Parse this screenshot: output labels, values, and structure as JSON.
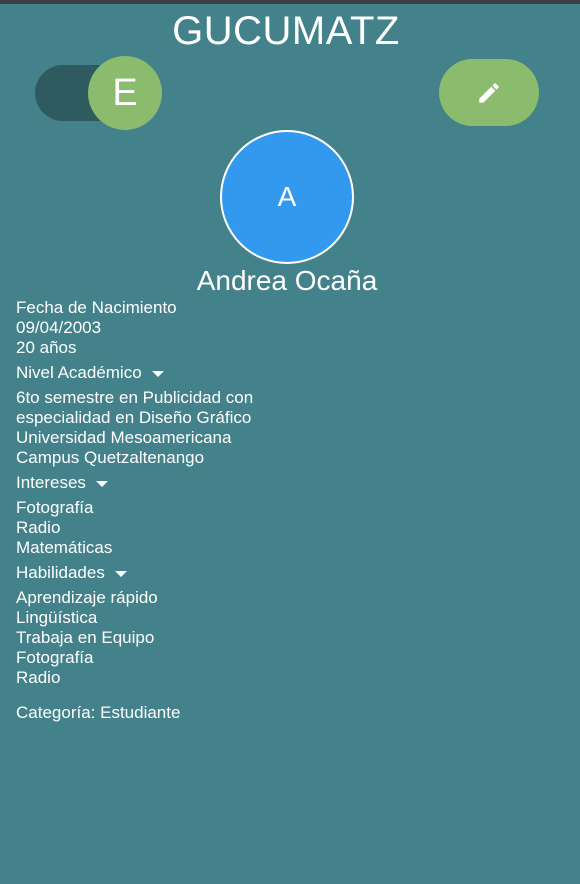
{
  "app": {
    "title": "GUCUMATZ"
  },
  "toggle": {
    "thumb_letter": "E"
  },
  "edit": {
    "icon": "pencil-icon"
  },
  "profile": {
    "avatar_letter": "A",
    "name": "Andrea Ocaña"
  },
  "birth": {
    "label": "Fecha de Nacimiento",
    "date": "09/04/2003",
    "age": "20 años"
  },
  "academic": {
    "label": "Nivel Académico",
    "lines": [
      "6to semestre en Publicidad con",
      "especialidad en Diseño Gráfico",
      "Universidad Mesoamericana",
      "Campus Quetzaltenango"
    ]
  },
  "interests": {
    "label": "Intereses",
    "items": [
      "Fotografía",
      "Radio",
      "Matemáticas"
    ]
  },
  "skills": {
    "label": "Habilidades",
    "items": [
      "Aprendizaje rápido",
      "Lingüística",
      "Trabaja en Equipo",
      "Fotografía",
      "Radio"
    ]
  },
  "category": {
    "text": "Categoría: Estudiante"
  },
  "colors": {
    "background": "#43828a",
    "accent_green": "#8bbb6c",
    "avatar_blue": "#3399ee",
    "switch_track": "#2f5a60"
  }
}
